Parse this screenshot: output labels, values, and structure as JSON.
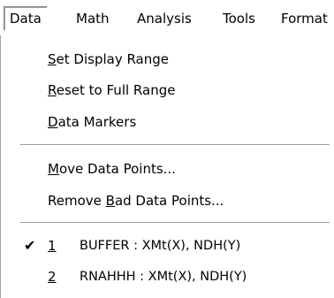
{
  "menubar": {
    "items": [
      {
        "label": "Data",
        "active": true
      },
      {
        "label": "Math"
      },
      {
        "label": "Analysis"
      },
      {
        "label": "Tools"
      },
      {
        "label": "Format"
      }
    ]
  },
  "menu": {
    "set_display_range": {
      "mnemonic": "S",
      "rest": "et Display Range"
    },
    "reset_full_range": {
      "mnemonic": "R",
      "rest": "eset to Full Range"
    },
    "data_markers": {
      "mnemonic": "D",
      "rest": "ata Markers"
    },
    "move_data_points": {
      "mnemonic": "M",
      "rest": "ove Data Points..."
    },
    "remove_bad": {
      "before": "Remove ",
      "mnemonic": "B",
      "rest": "ad Data Points..."
    },
    "datasets": [
      {
        "check": "✔",
        "number": "1",
        "label": "BUFFER : XMt(X), NDH(Y)",
        "checked": true
      },
      {
        "check": "",
        "number": "2",
        "label": "RNAHHH : XMt(X), NDH(Y)",
        "checked": false
      }
    ]
  }
}
